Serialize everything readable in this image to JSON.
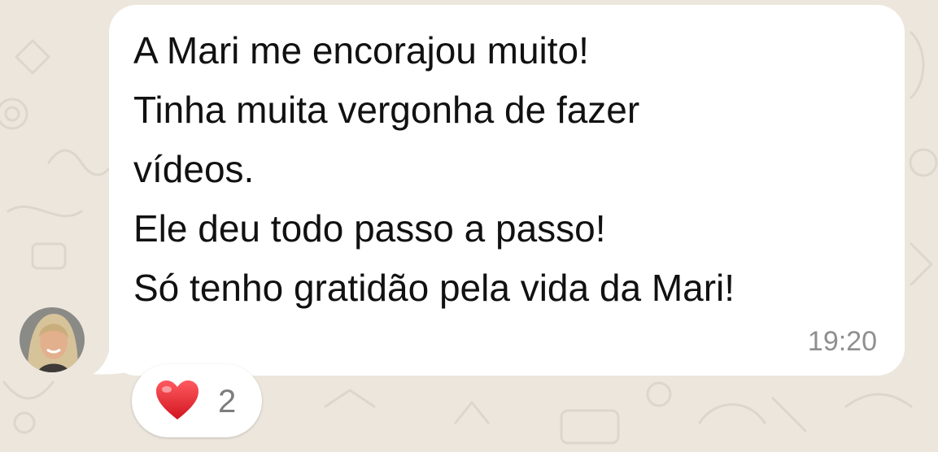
{
  "message": {
    "lines": [
      "A Mari me encorajou muito!",
      "Tinha muita vergonha de fazer",
      "vídeos.",
      "Ele deu todo passo a passo!",
      "Só tenho gratidão pela vida da Mari!"
    ],
    "time": "19:20"
  },
  "reaction": {
    "icon": "heart-icon",
    "count": "2"
  },
  "colors": {
    "wallpaper": "#ece6dd",
    "bubble": "#ffffff",
    "text": "#111111",
    "timestamp": "#8f8f8f",
    "heart": "#e0202e"
  }
}
